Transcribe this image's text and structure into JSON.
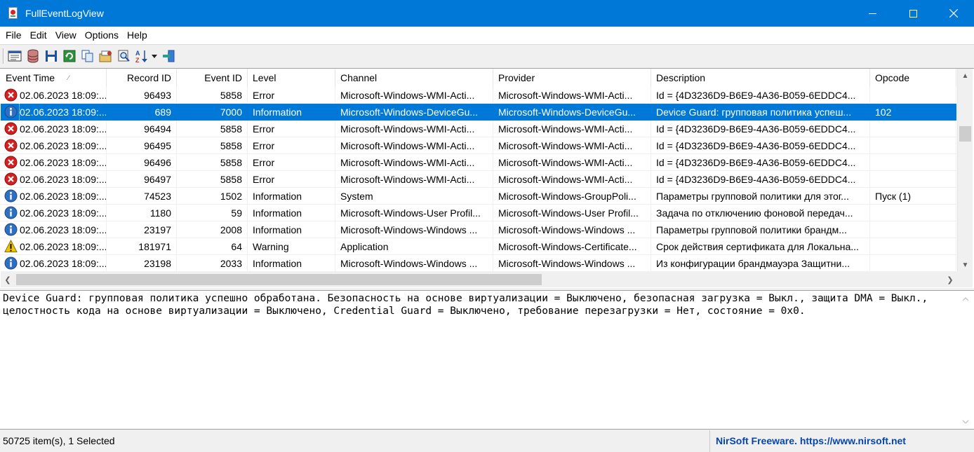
{
  "window": {
    "title": "FullEventLogView",
    "app_icon": "fulleventlogview-app-icon",
    "controls": [
      "minimize-icon",
      "maximize-icon",
      "close-icon"
    ]
  },
  "menu": [
    "File",
    "Edit",
    "View",
    "Options",
    "Help"
  ],
  "toolbar": {
    "buttons": [
      "properties-icon",
      "data-source-icon",
      "save-icon",
      "refresh-icon",
      "copy-icon",
      "options-icon",
      "find-icon",
      "sort-icon",
      "exit-icon"
    ]
  },
  "columns": [
    {
      "label": "Event Time",
      "align": "left"
    },
    {
      "label": "Record ID",
      "align": "right"
    },
    {
      "label": "Event ID",
      "align": "right"
    },
    {
      "label": "Level",
      "align": "left"
    },
    {
      "label": "Channel",
      "align": "left"
    },
    {
      "label": "Provider",
      "align": "left"
    },
    {
      "label": "Description",
      "align": "left"
    },
    {
      "label": "Opcode",
      "align": "left"
    }
  ],
  "rows": [
    {
      "icon": "error",
      "time": "02.06.2023 18:09:...",
      "record": "96493",
      "event": "5858",
      "level": "Error",
      "channel": "Microsoft-Windows-WMI-Acti...",
      "provider": "Microsoft-Windows-WMI-Acti...",
      "description": "Id = {4D3236D9-B6E9-4A36-B059-6EDDC4...",
      "opcode": ""
    },
    {
      "icon": "information",
      "time": "02.06.2023 18:09:...",
      "record": "689",
      "event": "7000",
      "level": "Information",
      "channel": "Microsoft-Windows-DeviceGu...",
      "provider": "Microsoft-Windows-DeviceGu...",
      "description": "Device Guard: групповая политика успеш...",
      "opcode": "102",
      "selected": true
    },
    {
      "icon": "error",
      "time": "02.06.2023 18:09:...",
      "record": "96494",
      "event": "5858",
      "level": "Error",
      "channel": "Microsoft-Windows-WMI-Acti...",
      "provider": "Microsoft-Windows-WMI-Acti...",
      "description": "Id = {4D3236D9-B6E9-4A36-B059-6EDDC4...",
      "opcode": ""
    },
    {
      "icon": "error",
      "time": "02.06.2023 18:09:...",
      "record": "96495",
      "event": "5858",
      "level": "Error",
      "channel": "Microsoft-Windows-WMI-Acti...",
      "provider": "Microsoft-Windows-WMI-Acti...",
      "description": "Id = {4D3236D9-B6E9-4A36-B059-6EDDC4...",
      "opcode": ""
    },
    {
      "icon": "error",
      "time": "02.06.2023 18:09:...",
      "record": "96496",
      "event": "5858",
      "level": "Error",
      "channel": "Microsoft-Windows-WMI-Acti...",
      "provider": "Microsoft-Windows-WMI-Acti...",
      "description": "Id = {4D3236D9-B6E9-4A36-B059-6EDDC4...",
      "opcode": ""
    },
    {
      "icon": "error",
      "time": "02.06.2023 18:09:...",
      "record": "96497",
      "event": "5858",
      "level": "Error",
      "channel": "Microsoft-Windows-WMI-Acti...",
      "provider": "Microsoft-Windows-WMI-Acti...",
      "description": "Id = {4D3236D9-B6E9-4A36-B059-6EDDC4...",
      "opcode": ""
    },
    {
      "icon": "information",
      "time": "02.06.2023 18:09:...",
      "record": "74523",
      "event": "1502",
      "level": "Information",
      "channel": "System",
      "provider": "Microsoft-Windows-GroupPoli...",
      "description": "Параметры групповой политики для этог...",
      "opcode": "Пуск (1)"
    },
    {
      "icon": "information",
      "time": "02.06.2023 18:09:...",
      "record": "1180",
      "event": "59",
      "level": "Information",
      "channel": "Microsoft-Windows-User Profil...",
      "provider": "Microsoft-Windows-User Profil...",
      "description": "Задача по отключению фоновой передач...",
      "opcode": ""
    },
    {
      "icon": "information",
      "time": "02.06.2023 18:09:...",
      "record": "23197",
      "event": "2008",
      "level": "Information",
      "channel": "Microsoft-Windows-Windows ...",
      "provider": "Microsoft-Windows-Windows ...",
      "description": "Параметры групповой политики брандм...",
      "opcode": ""
    },
    {
      "icon": "warning",
      "time": "02.06.2023 18:09:...",
      "record": "181971",
      "event": "64",
      "level": "Warning",
      "channel": "Application",
      "provider": "Microsoft-Windows-Certificate...",
      "description": "Срок действия сертификата для Локальна...",
      "opcode": ""
    },
    {
      "icon": "information",
      "time": "02.06.2023 18:09:...",
      "record": "23198",
      "event": "2033",
      "level": "Information",
      "channel": "Microsoft-Windows-Windows ...",
      "provider": "Microsoft-Windows-Windows ...",
      "description": "Из конфигурации брандмауэра Защитни...",
      "opcode": ""
    }
  ],
  "detail_text": "Device Guard: групповая политика успешно обработана. Безопасность на основе виртуализации = Выключено, безопасная загрузка = Выкл., защита DMA = Выкл., целостность кода на основе виртуализации = Выключено, Credential Guard = Выключено, требование перезагрузки = Нет, состояние = 0x0.",
  "status": {
    "count": "50725 item(s), 1 Selected",
    "link": "NirSoft Freeware. https://www.nirsoft.net"
  },
  "colors": {
    "titlebar": "#0078d7",
    "selection": "#0078d7",
    "error": "#d42020",
    "information": "#2f6fc0",
    "warning": "#f3c200",
    "link": "#0645ad"
  }
}
